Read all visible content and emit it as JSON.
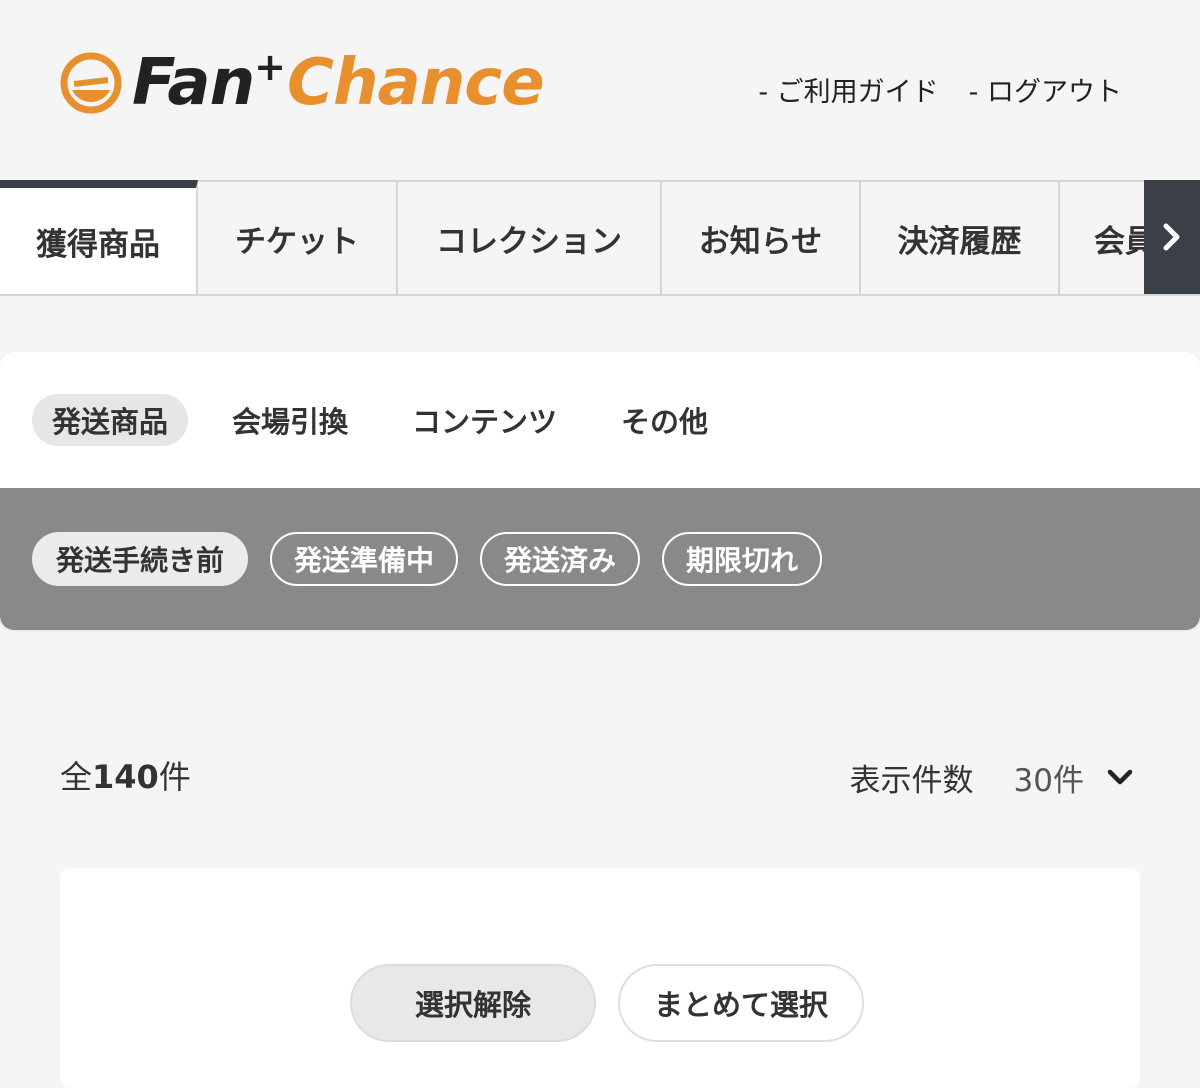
{
  "brand": {
    "name_part1": "Fan",
    "name_plus": "+",
    "name_part2": "Chance",
    "accent": "#e8902e"
  },
  "header": {
    "links": [
      "- ご利用ガイド",
      "- ログアウト"
    ]
  },
  "main_tabs": [
    "獲得商品",
    "チケット",
    "コレクション",
    "お知らせ",
    "決済履歴",
    "会員"
  ],
  "sub_tabs": [
    "発送商品",
    "会場引換",
    "コンテンツ",
    "その他"
  ],
  "status_filters": [
    "発送手続き前",
    "発送準備中",
    "発送済み",
    "期限切れ"
  ],
  "results": {
    "count_prefix": "全",
    "count": "140",
    "count_suffix": "件",
    "per_page_label": "表示件数",
    "per_page_value": "30件"
  },
  "actions": {
    "clear_selection": "選択解除",
    "bulk_select": "まとめて選択"
  },
  "icons": {
    "tab_next": "chevron-right-icon",
    "dropdown": "chevron-down-icon"
  },
  "colors": {
    "dark_tab": "#3a3f48",
    "status_bar": "#898989"
  }
}
